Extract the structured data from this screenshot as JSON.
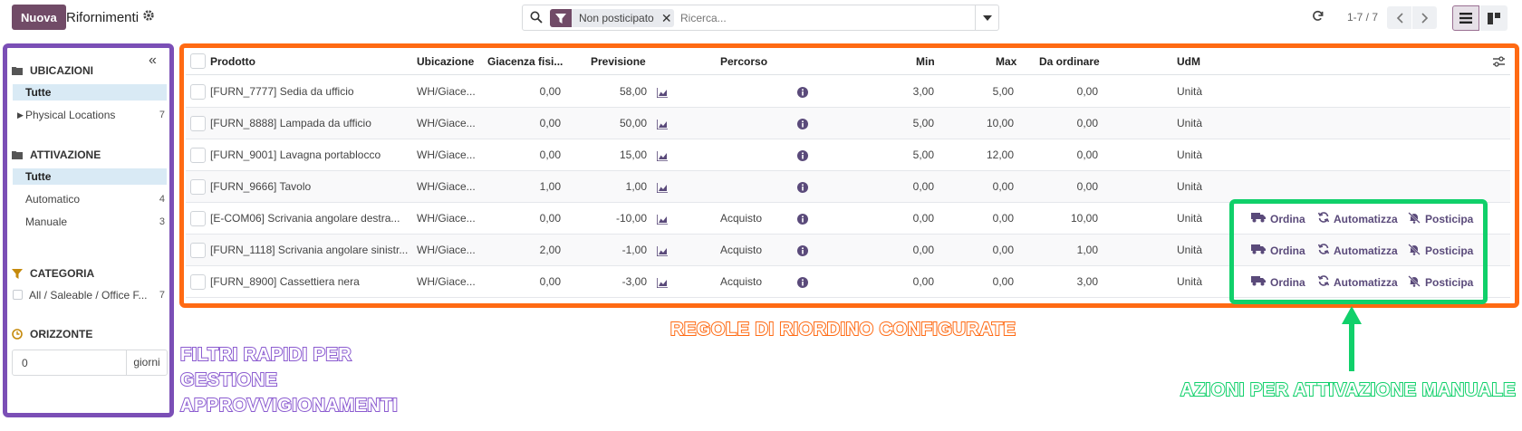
{
  "header": {
    "new_button": "Nuova",
    "title": "Rifornimenti",
    "facet_label": "Non posticipato",
    "search_placeholder": "Ricerca...",
    "pager": "1-7 / 7"
  },
  "sidebar": {
    "sections": [
      {
        "title": "UBICAZIONI",
        "icon": "folder-icon"
      },
      {
        "title": "ATTIVAZIONE",
        "icon": "folder-icon"
      },
      {
        "title": "CATEGORIA",
        "icon": "filter-icon"
      },
      {
        "title": "ORIZZONTE",
        "icon": "clock-icon"
      }
    ],
    "locations": [
      {
        "label": "Tutte",
        "count": ""
      },
      {
        "label": "Physical Locations",
        "count": "7"
      }
    ],
    "triggers": [
      {
        "label": "Tutte",
        "count": ""
      },
      {
        "label": "Automatico",
        "count": "4"
      },
      {
        "label": "Manuale",
        "count": "3"
      }
    ],
    "category": {
      "label": "All / Saleable / Office F...",
      "count": "7"
    },
    "horizon": {
      "value": "0",
      "unit": "giorni"
    }
  },
  "table": {
    "headers": [
      "Prodotto",
      "Ubicazione",
      "Giacenza fisi...",
      "Previsione",
      "Percorso",
      "Min",
      "Max",
      "Da ordinare",
      "UdM"
    ],
    "rows": [
      {
        "product": "[FURN_7777] Sedia da ufficio",
        "location": "WH/Giace...",
        "on_hand": "0,00",
        "forecast": "58,00",
        "route": "",
        "min": "3,00",
        "max": "5,00",
        "to_order": "0,00",
        "uom": "Unità"
      },
      {
        "product": "[FURN_8888] Lampada da ufficio",
        "location": "WH/Giace...",
        "on_hand": "0,00",
        "forecast": "50,00",
        "route": "",
        "min": "5,00",
        "max": "10,00",
        "to_order": "0,00",
        "uom": "Unità"
      },
      {
        "product": "[FURN_9001] Lavagna portablocco",
        "location": "WH/Giace...",
        "on_hand": "0,00",
        "forecast": "15,00",
        "route": "",
        "min": "5,00",
        "max": "12,00",
        "to_order": "0,00",
        "uom": "Unità"
      },
      {
        "product": "[FURN_9666] Tavolo",
        "location": "WH/Giace...",
        "on_hand": "1,00",
        "forecast": "1,00",
        "route": "",
        "min": "0,00",
        "max": "0,00",
        "to_order": "0,00",
        "uom": "Unità"
      },
      {
        "product": "[E-COM06] Scrivania angolare destra...",
        "location": "WH/Giace...",
        "on_hand": "0,00",
        "forecast": "-10,00",
        "route": "Acquisto",
        "min": "0,00",
        "max": "0,00",
        "to_order": "10,00",
        "uom": "Unità"
      },
      {
        "product": "[FURN_1118] Scrivania angolare sinistr...",
        "location": "WH/Giace...",
        "on_hand": "2,00",
        "forecast": "-1,00",
        "route": "Acquisto",
        "min": "0,00",
        "max": "0,00",
        "to_order": "1,00",
        "uom": "Unità"
      },
      {
        "product": "[FURN_8900] Cassettiera nera",
        "location": "WH/Giace...",
        "on_hand": "0,00",
        "forecast": "-3,00",
        "route": "Acquisto",
        "min": "0,00",
        "max": "0,00",
        "to_order": "3,00",
        "uom": "Unità"
      }
    ],
    "actions": {
      "order": "Ordina",
      "automate": "Automatizza",
      "snooze": "Posticipa"
    }
  },
  "annotations": {
    "filters": "FILTRI RAPIDI PER GESTIONE APPROVVIGIONAMENTI",
    "rules": "REGOLE DI RIORDINO CONFIGURATE",
    "actions": "AZIONI PER ATTIVAZIONE MANUALE"
  },
  "colors": {
    "brand": "#714B67",
    "purple": "#7b4fb6",
    "orange": "#ff6a13",
    "green": "#10d06a"
  }
}
